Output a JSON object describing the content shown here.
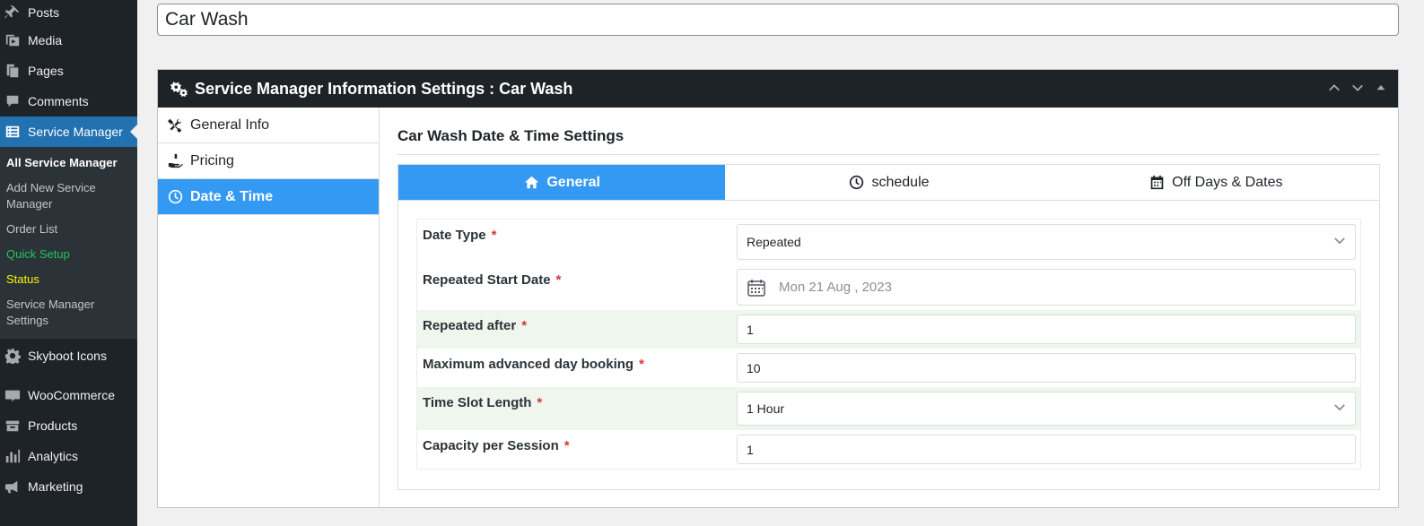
{
  "sidebar": {
    "top_items": [
      {
        "label": "Posts",
        "icon": "pin-icon"
      },
      {
        "label": "Media",
        "icon": "media-icon"
      },
      {
        "label": "Pages",
        "icon": "pages-icon"
      },
      {
        "label": "Comments",
        "icon": "comments-icon"
      }
    ],
    "active_item": {
      "label": "Service Manager",
      "icon": "list-icon"
    },
    "submenu": [
      {
        "label": "All Service Manager",
        "style": "current"
      },
      {
        "label": "Add New Service Manager",
        "style": "normal"
      },
      {
        "label": "Order List",
        "style": "normal"
      },
      {
        "label": "Quick Setup",
        "style": "green"
      },
      {
        "label": "Status",
        "style": "yellow"
      },
      {
        "label": "Service Manager Settings",
        "style": "normal"
      }
    ],
    "bottom_items": [
      {
        "label": "Skyboot Icons",
        "icon": "gear-icon"
      },
      {
        "label": "WooCommerce",
        "icon": "woo-icon"
      },
      {
        "label": "Products",
        "icon": "products-icon"
      },
      {
        "label": "Analytics",
        "icon": "analytics-icon"
      },
      {
        "label": "Marketing",
        "icon": "megaphone-icon"
      }
    ]
  },
  "post_title": "Car Wash",
  "postbox": {
    "title": "Service Manager Information Settings : Car Wash",
    "left_tabs": [
      {
        "label": "General Info",
        "icon": "tools-icon"
      },
      {
        "label": "Pricing",
        "icon": "hand-coin-icon"
      },
      {
        "label": "Date & Time",
        "icon": "clock-icon"
      }
    ],
    "section_title": "Car Wash Date & Time Settings",
    "top_tabs": [
      {
        "label": "General",
        "icon": "home-icon"
      },
      {
        "label": "schedule",
        "icon": "clock-icon"
      },
      {
        "label": "Off Days & Dates",
        "icon": "calendar-icon"
      }
    ],
    "form": {
      "date_type": {
        "label": "Date Type",
        "value": "Repeated"
      },
      "repeated_start_date": {
        "label": "Repeated Start Date",
        "value": "Mon 21 Aug , 2023"
      },
      "repeated_after": {
        "label": "Repeated after",
        "value": "1"
      },
      "max_advance_booking": {
        "label": "Maximum advanced day booking",
        "value": "10"
      },
      "time_slot_length": {
        "label": "Time Slot Length",
        "value": "1 Hour"
      },
      "capacity_per_session": {
        "label": "Capacity per Session",
        "value": "1"
      },
      "required_mark": "*"
    }
  },
  "colors": {
    "sidebar_bg": "#1d2327",
    "active_blue": "#2271b1",
    "tab_blue": "#3399f3",
    "required_red": "#d63638"
  }
}
